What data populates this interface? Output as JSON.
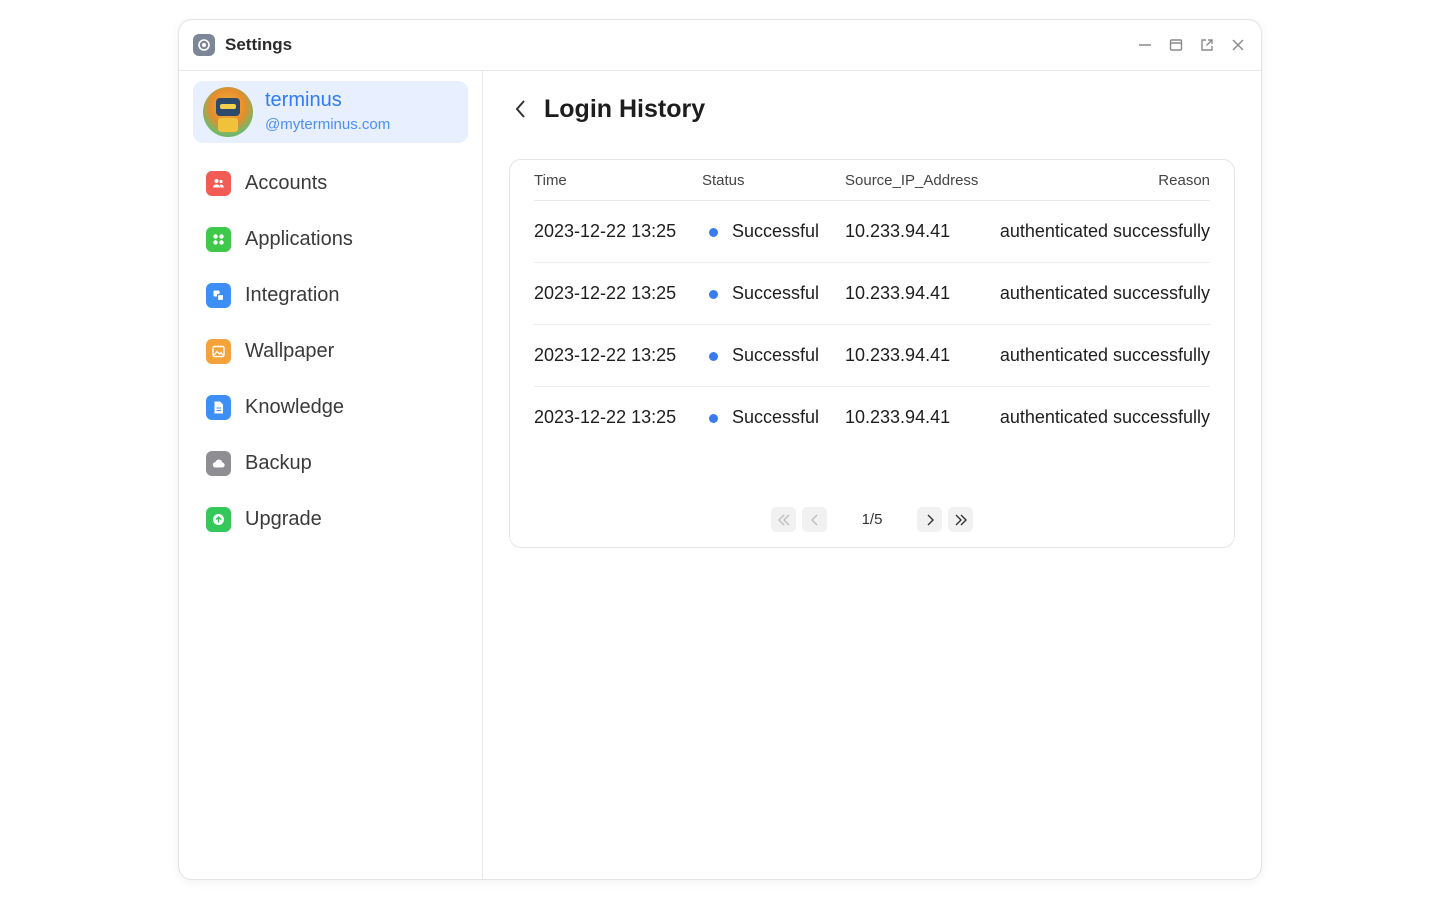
{
  "window": {
    "title": "Settings",
    "icon": "settings-icon",
    "controls": [
      "minimize-icon",
      "maximize-icon",
      "open-external-icon",
      "close-icon"
    ]
  },
  "profile": {
    "name": "terminus",
    "domain": "@myterminus.com"
  },
  "sidebar": {
    "items": [
      {
        "label": "Accounts",
        "icon": "accounts-icon",
        "color": "#f25c54"
      },
      {
        "label": "Applications",
        "icon": "applications-icon",
        "color": "#3fc94b"
      },
      {
        "label": "Integration",
        "icon": "integration-icon",
        "color": "#3b8ff6"
      },
      {
        "label": "Wallpaper",
        "icon": "wallpaper-icon",
        "color": "#f6a23a"
      },
      {
        "label": "Knowledge",
        "icon": "knowledge-icon",
        "color": "#3b8ff6"
      },
      {
        "label": "Backup",
        "icon": "backup-icon",
        "color": "#8e8e93"
      },
      {
        "label": "Upgrade",
        "icon": "upgrade-icon",
        "color": "#34c759"
      }
    ]
  },
  "page": {
    "title": "Login History"
  },
  "table": {
    "columns": [
      "Time",
      "Status",
      "Source_IP_Address",
      "Reason"
    ],
    "rows": [
      {
        "time": "2023-12-22 13:25",
        "status": "Successful",
        "ip": "10.233.94.41",
        "reason": "authenticated successfully"
      },
      {
        "time": "2023-12-22 13:25",
        "status": "Successful",
        "ip": "10.233.94.41",
        "reason": "authenticated successfully"
      },
      {
        "time": "2023-12-22 13:25",
        "status": "Successful",
        "ip": "10.233.94.41",
        "reason": "authenticated successfully"
      },
      {
        "time": "2023-12-22 13:25",
        "status": "Successful",
        "ip": "10.233.94.41",
        "reason": "authenticated successfully"
      }
    ]
  },
  "pagination": {
    "label": "1/5"
  },
  "colors": {
    "accent": "#2f7cf6",
    "status_success_dot": "#3b7bf2",
    "profile_card_bg": "#e8efff"
  }
}
